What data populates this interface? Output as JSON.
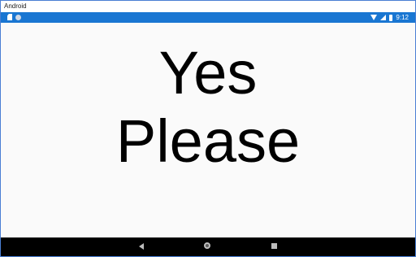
{
  "window": {
    "title": "Android"
  },
  "status_bar": {
    "time": "9:12",
    "color": "#1976d2",
    "icons_left": [
      "sd-card-icon",
      "sync-icon"
    ],
    "icons_right": [
      "wifi-icon",
      "signal-icon",
      "battery-icon"
    ]
  },
  "content": {
    "line1": "Yes",
    "line2": "Please"
  },
  "nav_bar": {
    "buttons": [
      "back",
      "home",
      "recent-apps"
    ]
  }
}
